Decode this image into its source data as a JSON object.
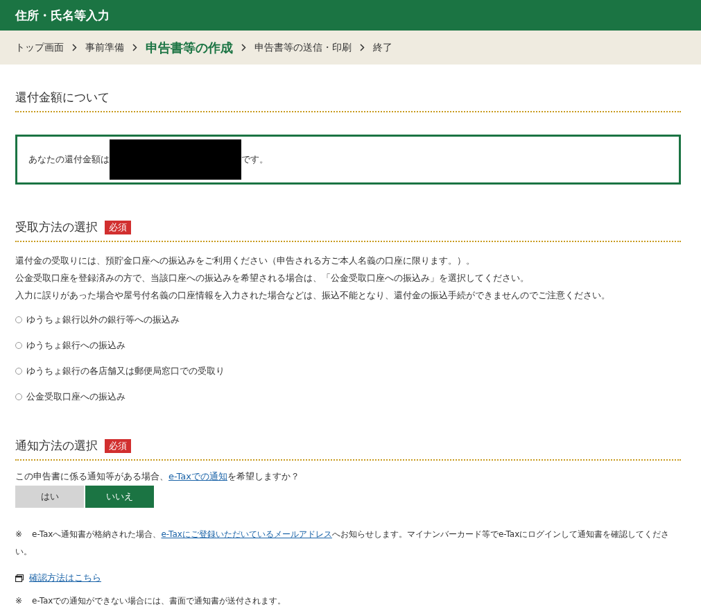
{
  "header": {
    "title": "住所・氏名等入力"
  },
  "breadcrumb": [
    {
      "label": "トップ画面",
      "selected": false
    },
    {
      "label": "事前準備",
      "selected": false
    },
    {
      "label": "申告書等の作成",
      "selected": true
    },
    {
      "label": "申告書等の送信・印刷",
      "selected": false
    },
    {
      "label": "終了",
      "selected": false
    }
  ],
  "refund": {
    "heading": "還付金額について",
    "before": "あなたの還付金額は",
    "after": "です。"
  },
  "receipt": {
    "heading": "受取方法の選択",
    "badge": "必須",
    "paragraphs": [
      "還付金の受取りには、預貯金口座への振込みをご利用ください（申告される方ご本人名義の口座に限ります。）。",
      "公金受取口座を登録済みの方で、当該口座への振込みを希望される場合は、「公金受取口座への振込み」を選択してください。",
      "入力に誤りがあった場合や屋号付名義の口座情報を入力された場合などは、振込不能となり、還付金の振込手続ができませんのでご注意ください。"
    ],
    "options": [
      {
        "label": "ゆうちょ銀行以外の銀行等への振込み",
        "selected": false
      },
      {
        "label": "ゆうちょ銀行への振込み",
        "selected": false
      },
      {
        "label": "ゆうちょ銀行の各店舗又は郵便局窓口での受取り",
        "selected": false
      },
      {
        "label": "公金受取口座への振込み",
        "selected": false
      }
    ]
  },
  "notification": {
    "heading": "通知方法の選択",
    "badge": "必須",
    "question": {
      "before": "この申告書に係る通知等がある場合、",
      "link": "e-Taxでの通知",
      "after": "を希望しますか？"
    },
    "choices": [
      {
        "label": "はい",
        "selected": false
      },
      {
        "label": "いいえ",
        "selected": true
      }
    ],
    "note1": {
      "mark": "※",
      "before": "e-Taxへ通知書が格納された場合、",
      "link": "e-Taxにご登録いただいているメールアドレス",
      "after": "へお知らせします。マイナンバーカード等でe-Taxにログインして通知書を確認してください。"
    },
    "help_link": "確認方法はこちら",
    "note2": {
      "mark": "※",
      "text": "e-Taxでの通知ができない場合には、書面で通知書が送付されます。"
    }
  }
}
